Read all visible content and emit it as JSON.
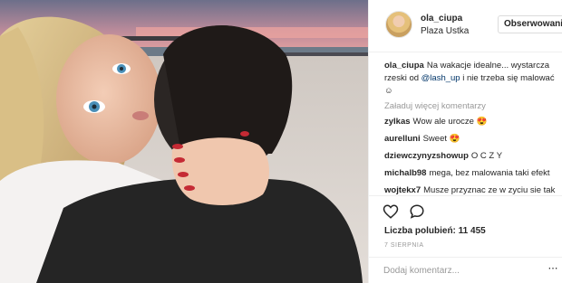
{
  "post": {
    "username": "ola_ciupa",
    "location": "Plaza Ustka",
    "follow_label": "Obserwowanie",
    "caption": {
      "user": "ola_ciupa",
      "text_before": "Na wakacje idealne... wystarcza rzeski od ",
      "mention": "@lash_up",
      "text_after": " i nie trzeba się malować ☺"
    },
    "load_more_label": "Załaduj więcej komentarzy",
    "comments": [
      {
        "user": "zylkas",
        "text": "Wow ale urocze 😍"
      },
      {
        "user": "aurelluni",
        "text": "Sweet 😍"
      },
      {
        "user": "dziewczynyzshowup",
        "text": "O C Z Y"
      },
      {
        "user": "michalb98",
        "text": "mega, bez malowania taki efekt"
      },
      {
        "user": "wojtekx7",
        "text": "Musze przyznac ze w zyciu sie tak dobrze nier bawilem. dobrze ze mam"
      }
    ],
    "likes_text": "Liczba polubień: 11 455",
    "date": "7 SIERPNIA",
    "add_comment_placeholder": "Dodaj komentarz...",
    "more_icon": "more-dots-icon",
    "like_icon": "heart-icon",
    "comment_icon": "speech-bubble-icon"
  },
  "colors": {
    "mention": "#003569",
    "secondary_text": "#999999",
    "border": "#efefef"
  }
}
